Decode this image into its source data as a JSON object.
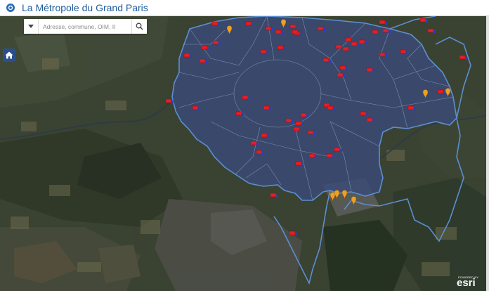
{
  "header": {
    "title": "La Métropole du Grand Paris"
  },
  "search": {
    "placeholder": "Adresse, commune, OIM, II"
  },
  "attribution": {
    "powered_by": "POWERED BY",
    "brand": "esri"
  },
  "colors": {
    "header_title": "#1f5c9e",
    "metropole_fill": "#3b4a78",
    "boundary": "#5b8fd0",
    "marker_red": "#e0202a",
    "marker_blue": "#2a3fbf",
    "marker_orange": "#f0a020"
  },
  "icons": {
    "logo": "grand-paris-logo-icon",
    "dropdown": "chevron-down-icon",
    "search": "search-icon",
    "home": "home-icon"
  }
}
